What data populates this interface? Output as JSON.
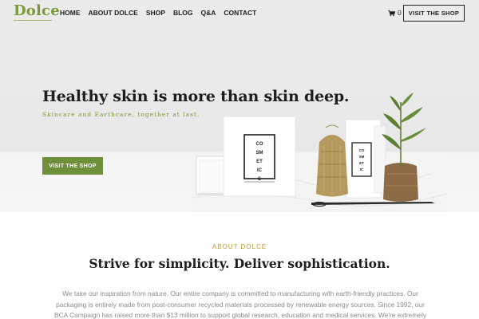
{
  "header": {
    "logo": "Dolce",
    "nav": [
      "HOME",
      "ABOUT DOLCE",
      "SHOP",
      "BLOG",
      "Q&A",
      "CONTACT"
    ],
    "cart_count": "0",
    "cart_icon": "shopping-cart-icon",
    "cta_label": "VISIT THE SHOP"
  },
  "hero": {
    "title": "Healthy skin is more than skin deep.",
    "subtitle": "Skincare and Earthcare, together at last.",
    "cta_label": "VISIT THE SHOP",
    "product_box_text": [
      "CO",
      "SM",
      "ET",
      "IC",
      "S"
    ]
  },
  "about": {
    "label": "ABOUT DOLCE",
    "title": "Strive for simplicity. Deliver sophistication.",
    "body": "We take our inspiration from nature. Our entire company is committed to manufacturing with earth-friendly practices. Our packaging is entirely made from post-consumer recycled materials processed by renewable energy sources. Since 1992, our BCA Campaign has raised more than $13 million to support global research, education and medical services. We're extremely proud of"
  },
  "colors": {
    "brand_green": "#7a9a3c",
    "button_green": "#6f8f3a",
    "gold_label": "#c39a2e",
    "header_bg": "#ebebeb"
  }
}
